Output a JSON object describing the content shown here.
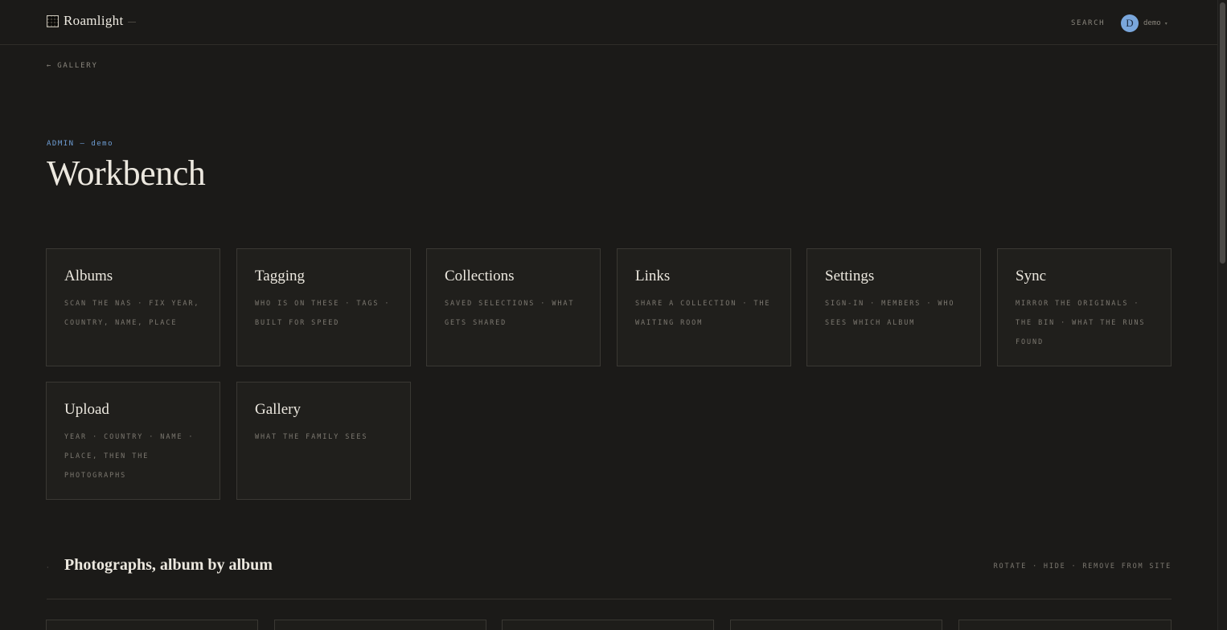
{
  "brand": {
    "name": "Roamlight",
    "logo_icon": "photo-stack-icon"
  },
  "header": {
    "search_label": "SEARCH",
    "user": {
      "initial": "D",
      "name": "demo",
      "caret": "▾",
      "avatar_color": "#7aa7dc"
    }
  },
  "nav": {
    "back_arrow": "←",
    "back_label": "GALLERY"
  },
  "page": {
    "eyebrow": "ADMIN — demo",
    "title": "Workbench",
    "accent": "#6f9fd6"
  },
  "cards": [
    {
      "title": "Albums",
      "desc": "SCAN THE NAS · FIX YEAR, COUNTRY, NAME, PLACE"
    },
    {
      "title": "Tagging",
      "desc": "WHO IS ON THESE · TAGS · BUILT FOR SPEED"
    },
    {
      "title": "Collections",
      "desc": "SAVED SELECTIONS · WHAT GETS SHARED"
    },
    {
      "title": "Links",
      "desc": "SHARE A COLLECTION · THE WAITING ROOM"
    },
    {
      "title": "Settings",
      "desc": "SIGN-IN · MEMBERS · WHO SEES WHICH ALBUM"
    },
    {
      "title": "Sync",
      "desc": "MIRROR THE ORIGINALS · THE BIN · WHAT THE RUNS FOUND"
    },
    {
      "title": "Upload",
      "desc": "YEAR · COUNTRY · NAME · PLACE, THEN THE PHOTOGRAPHS"
    },
    {
      "title": "Gallery",
      "desc": "WHAT THE FAMILY SEES"
    }
  ],
  "section": {
    "dot": "·",
    "title": "Photographs, album by album",
    "actions": "ROTATE · HIDE · REMOVE FROM SITE"
  }
}
